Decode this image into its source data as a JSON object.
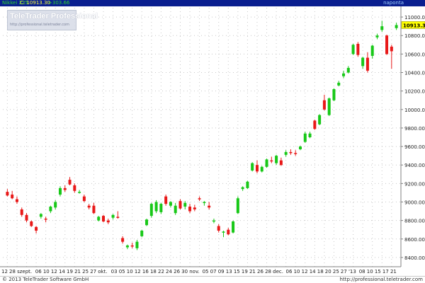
{
  "header": {
    "symbol": "Nikkei 225",
    "close_label": "C: 10913.30",
    "change_label": "+303.66",
    "period": "naponta"
  },
  "watermark": {
    "title": "TeleTrader Professional",
    "url": "http://professional.teletrader.com"
  },
  "footer": {
    "copyright": "© 2013 TeleTrader Software GmbH",
    "url": "http://professional.teletrader.com"
  },
  "colors": {
    "up": "#18c818",
    "down": "#e81818",
    "header_bg": "#0a1f8f",
    "last_price_box": "#ffff00",
    "grid_dots": "#c8c8c8"
  },
  "chart_data": {
    "type": "candlestick",
    "series_name": "Nikkei 225",
    "last_price_label": "10913.30",
    "y_axis": {
      "min": 8300,
      "max": 11100,
      "ticks": [
        8400,
        8600,
        8800,
        9000,
        9200,
        9400,
        9600,
        9800,
        10000,
        10200,
        10400,
        10600,
        10800,
        11000
      ],
      "tick_labels": [
        "8400.00",
        "8600.00",
        "8800.00",
        "9000.00",
        "9200.00",
        "9400.00",
        "9600.00",
        "9800.00",
        "10000.00",
        "10200.00",
        "10400.00",
        "10600.00",
        "10800.00",
        "11000.00"
      ],
      "position": "right"
    },
    "x_axis_labels": [
      "12",
      "28",
      "szept.",
      "06",
      "10",
      "12",
      "14",
      "19",
      "21",
      "25",
      "27",
      "okt.",
      "03",
      "05",
      "10",
      "12",
      "16",
      "18",
      "22",
      "24",
      "26",
      "30",
      "nov.",
      "05",
      "07",
      "09",
      "13",
      "15",
      "19",
      "21",
      "26",
      "28",
      "dec.",
      "06",
      "10",
      "12",
      "14",
      "18",
      "20",
      "25",
      "27",
      "'13",
      "08",
      "10",
      "15",
      "17",
      "21"
    ],
    "grid": true,
    "candles": [
      {
        "o": 9110,
        "h": 9140,
        "l": 9060,
        "c": 9070
      },
      {
        "o": 9080,
        "h": 9120,
        "l": 9030,
        "c": 9040
      },
      {
        "o": 9030,
        "h": 9060,
        "l": 8980,
        "c": 9000
      },
      {
        "o": 8920,
        "h": 8940,
        "l": 8840,
        "c": 8860
      },
      {
        "o": 8860,
        "h": 8880,
        "l": 8780,
        "c": 8800
      },
      {
        "o": 8790,
        "h": 8800,
        "l": 8730,
        "c": 8740
      },
      {
        "o": 8730,
        "h": 8740,
        "l": 8660,
        "c": 8690
      },
      {
        "o": 8840,
        "h": 8880,
        "l": 8820,
        "c": 8870
      },
      {
        "o": 8820,
        "h": 8840,
        "l": 8780,
        "c": 8810
      },
      {
        "o": 8900,
        "h": 8960,
        "l": 8880,
        "c": 8950
      },
      {
        "o": 8940,
        "h": 9020,
        "l": 8920,
        "c": 9000
      },
      {
        "o": 9080,
        "h": 9170,
        "l": 9060,
        "c": 9150
      },
      {
        "o": 9150,
        "h": 9180,
        "l": 9110,
        "c": 9130
      },
      {
        "o": 9240,
        "h": 9270,
        "l": 9180,
        "c": 9190
      },
      {
        "o": 9180,
        "h": 9200,
        "l": 9100,
        "c": 9120
      },
      {
        "o": 9110,
        "h": 9130,
        "l": 9090,
        "c": 9110
      },
      {
        "o": 9060,
        "h": 9080,
        "l": 9000,
        "c": 9010
      },
      {
        "o": 8960,
        "h": 8980,
        "l": 8920,
        "c": 8940
      },
      {
        "o": 8960,
        "h": 8990,
        "l": 8870,
        "c": 8880
      },
      {
        "o": 8800,
        "h": 8850,
        "l": 8790,
        "c": 8840
      },
      {
        "o": 8850,
        "h": 8860,
        "l": 8780,
        "c": 8790
      },
      {
        "o": 8800,
        "h": 8820,
        "l": 8760,
        "c": 8780
      },
      {
        "o": 8830,
        "h": 8870,
        "l": 8810,
        "c": 8860
      },
      {
        "o": 8840,
        "h": 8900,
        "l": 8820,
        "c": 8830
      },
      {
        "o": 8610,
        "h": 8630,
        "l": 8550,
        "c": 8570
      },
      {
        "o": 8510,
        "h": 8540,
        "l": 8490,
        "c": 8530
      },
      {
        "o": 8530,
        "h": 8560,
        "l": 8500,
        "c": 8520
      },
      {
        "o": 8500,
        "h": 8590,
        "l": 8480,
        "c": 8570
      },
      {
        "o": 8630,
        "h": 8700,
        "l": 8620,
        "c": 8690
      },
      {
        "o": 8750,
        "h": 8820,
        "l": 8740,
        "c": 8810
      },
      {
        "o": 8850,
        "h": 8990,
        "l": 8830,
        "c": 8980
      },
      {
        "o": 8900,
        "h": 9020,
        "l": 8880,
        "c": 9000
      },
      {
        "o": 8890,
        "h": 8990,
        "l": 8870,
        "c": 8980
      },
      {
        "o": 9060,
        "h": 9080,
        "l": 8960,
        "c": 8980
      },
      {
        "o": 8960,
        "h": 9010,
        "l": 8940,
        "c": 9000
      },
      {
        "o": 8880,
        "h": 8990,
        "l": 8860,
        "c": 8960
      },
      {
        "o": 9010,
        "h": 9030,
        "l": 8920,
        "c": 8930
      },
      {
        "o": 8950,
        "h": 9010,
        "l": 8920,
        "c": 8990
      },
      {
        "o": 8950,
        "h": 8980,
        "l": 8880,
        "c": 8900
      },
      {
        "o": 8940,
        "h": 8970,
        "l": 8900,
        "c": 8920
      },
      {
        "o": 9040,
        "h": 9060,
        "l": 9010,
        "c": 9030
      },
      {
        "o": 8990,
        "h": 9010,
        "l": 8960,
        "c": 9000
      },
      {
        "o": 8960,
        "h": 9000,
        "l": 8920,
        "c": 8940
      },
      {
        "o": 8790,
        "h": 8820,
        "l": 8770,
        "c": 8800
      },
      {
        "o": 8740,
        "h": 8760,
        "l": 8670,
        "c": 8690
      },
      {
        "o": 8670,
        "h": 8690,
        "l": 8620,
        "c": 8680
      },
      {
        "o": 8700,
        "h": 8720,
        "l": 8640,
        "c": 8650
      },
      {
        "o": 8670,
        "h": 8800,
        "l": 8660,
        "c": 8790
      },
      {
        "o": 8880,
        "h": 9060,
        "l": 8870,
        "c": 9040
      },
      {
        "o": 9140,
        "h": 9170,
        "l": 9120,
        "c": 9160
      },
      {
        "o": 9150,
        "h": 9230,
        "l": 9140,
        "c": 9220
      },
      {
        "o": 9340,
        "h": 9430,
        "l": 9330,
        "c": 9420
      },
      {
        "o": 9400,
        "h": 9450,
        "l": 9310,
        "c": 9330
      },
      {
        "o": 9330,
        "h": 9390,
        "l": 9320,
        "c": 9380
      },
      {
        "o": 9380,
        "h": 9470,
        "l": 9370,
        "c": 9460
      },
      {
        "o": 9450,
        "h": 9490,
        "l": 9420,
        "c": 9440
      },
      {
        "o": 9420,
        "h": 9510,
        "l": 9400,
        "c": 9500
      },
      {
        "o": 9450,
        "h": 9480,
        "l": 9390,
        "c": 9400
      },
      {
        "o": 9510,
        "h": 9560,
        "l": 9490,
        "c": 9540
      },
      {
        "o": 9540,
        "h": 9570,
        "l": 9510,
        "c": 9530
      },
      {
        "o": 9530,
        "h": 9560,
        "l": 9500,
        "c": 9520
      },
      {
        "o": 9570,
        "h": 9610,
        "l": 9560,
        "c": 9600
      },
      {
        "o": 9650,
        "h": 9760,
        "l": 9640,
        "c": 9740
      },
      {
        "o": 9700,
        "h": 9760,
        "l": 9690,
        "c": 9740
      },
      {
        "o": 9880,
        "h": 9890,
        "l": 9780,
        "c": 9790
      },
      {
        "o": 9840,
        "h": 9950,
        "l": 9830,
        "c": 9940
      },
      {
        "o": 10100,
        "h": 10160,
        "l": 9990,
        "c": 10000
      },
      {
        "o": 9940,
        "h": 10130,
        "l": 9930,
        "c": 10120
      },
      {
        "o": 10100,
        "h": 10230,
        "l": 10090,
        "c": 10220
      },
      {
        "o": 10260,
        "h": 10310,
        "l": 10250,
        "c": 10290
      },
      {
        "o": 10360,
        "h": 10420,
        "l": 10340,
        "c": 10390
      },
      {
        "o": 10400,
        "h": 10470,
        "l": 10390,
        "c": 10450
      },
      {
        "o": 10600,
        "h": 10710,
        "l": 10590,
        "c": 10700
      },
      {
        "o": 10710,
        "h": 10730,
        "l": 10570,
        "c": 10590
      },
      {
        "o": 10470,
        "h": 10570,
        "l": 10440,
        "c": 10560
      },
      {
        "o": 10560,
        "h": 10620,
        "l": 10400,
        "c": 10420
      },
      {
        "o": 10580,
        "h": 10700,
        "l": 10550,
        "c": 10690
      },
      {
        "o": 10780,
        "h": 10820,
        "l": 10760,
        "c": 10800
      },
      {
        "o": 10860,
        "h": 10960,
        "l": 10840,
        "c": 10900
      },
      {
        "o": 10800,
        "h": 10810,
        "l": 10590,
        "c": 10600
      },
      {
        "o": 10680,
        "h": 10700,
        "l": 10440,
        "c": 10630
      },
      {
        "o": 10880,
        "h": 10940,
        "l": 10860,
        "c": 10913.3
      }
    ]
  }
}
